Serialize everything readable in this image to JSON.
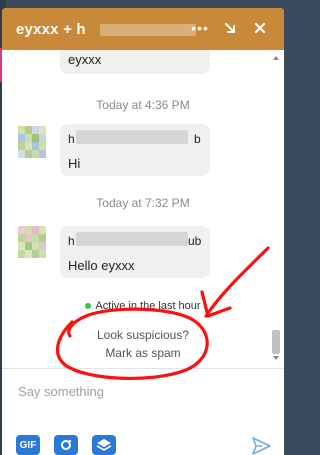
{
  "header": {
    "title": "eyxxx + h",
    "more_label": "•••",
    "colors": {
      "header_bg": "#c9893b"
    }
  },
  "messages": {
    "items": [
      {
        "type": "bubble_tail",
        "text": "eyxxx"
      },
      {
        "type": "timestamp",
        "text": "Today at 4:36 PM"
      },
      {
        "type": "bubble",
        "name_start": "h",
        "name_end": "b",
        "text": "Hi"
      },
      {
        "type": "timestamp",
        "text": "Today at 7:32 PM"
      },
      {
        "type": "bubble",
        "name_start": "h",
        "name_end": "ub",
        "text": "Hello eyxxx"
      }
    ],
    "status": "Active in the last hour",
    "spam_question": "Look suspicious?",
    "spam_link": "Mark as spam"
  },
  "composer": {
    "placeholder": "Say something",
    "gif_label": "GIF"
  },
  "icons": [
    "more-icon",
    "shrink-icon",
    "close-icon",
    "gif-icon",
    "camera-icon",
    "stickers-icon",
    "send-icon"
  ]
}
